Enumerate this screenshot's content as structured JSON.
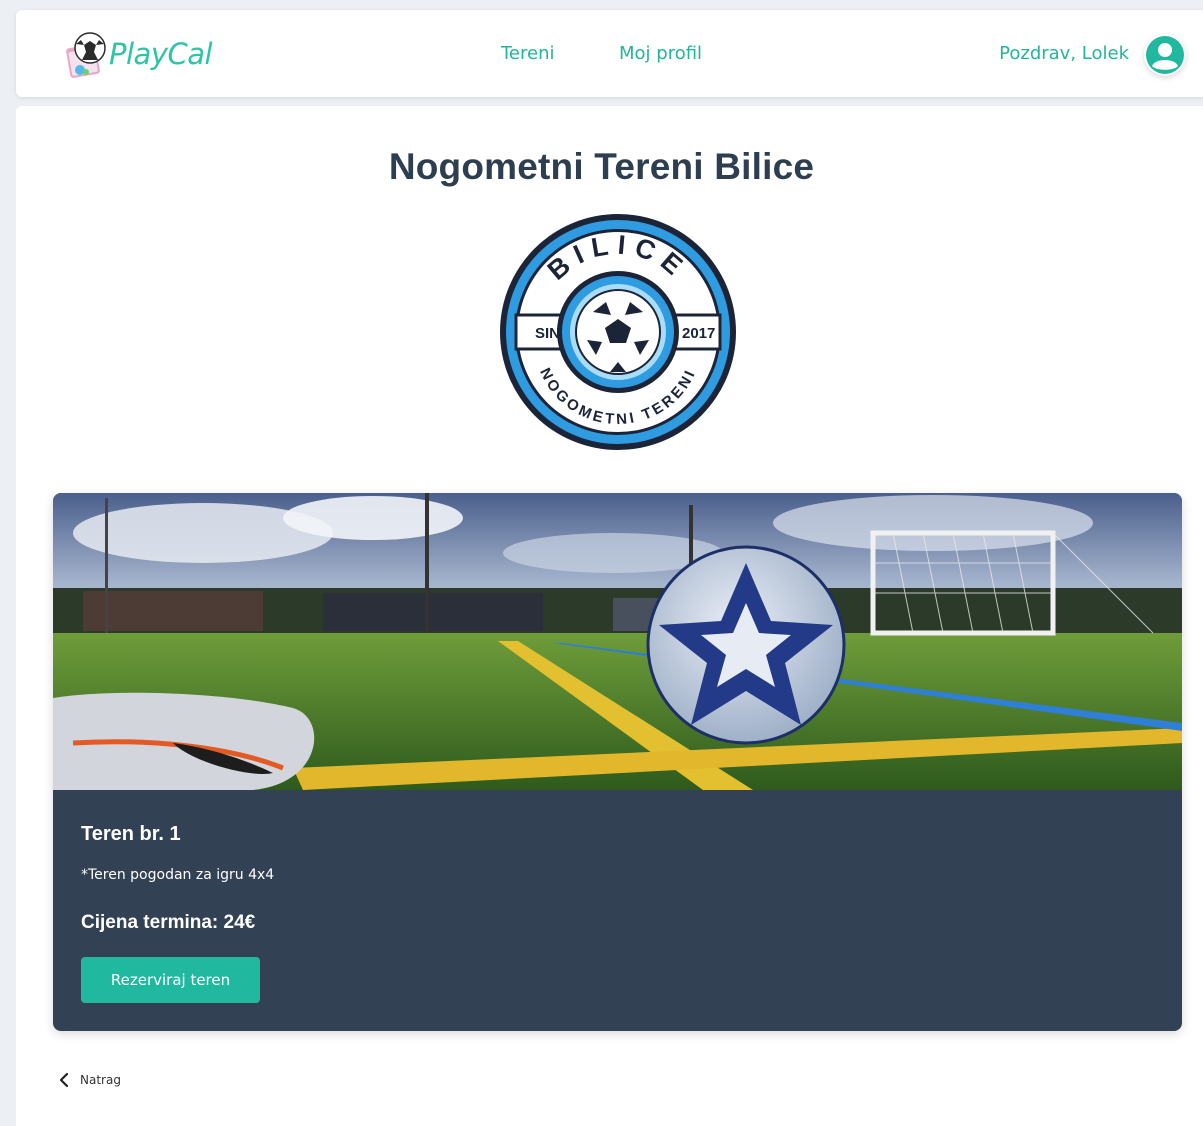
{
  "app": {
    "name": "PlayCal"
  },
  "nav": {
    "links": [
      {
        "label": "Tereni"
      },
      {
        "label": "Moj profil"
      }
    ],
    "greeting": "Pozdrav, Lolek"
  },
  "venue": {
    "title": "Nogometni Tereni Bilice",
    "logo": {
      "top_text": "BILICE",
      "left_text": "SINCE",
      "right_text": "2017",
      "bottom_text": "NOGOMETNI TERENI"
    }
  },
  "court": {
    "name": "Teren br. 1",
    "note": "*Teren pogodan za igru 4x4",
    "price_label": "Cijena termina: 24€",
    "reserve_label": "Rezerviraj teren"
  },
  "back": {
    "label": "Natrag"
  },
  "colors": {
    "accent": "#20b9a0",
    "card_bg": "#334155",
    "title": "#2c3e50",
    "badge_blue": "#2f9be0",
    "badge_navy": "#1c2438"
  },
  "icons": {
    "user": "user-avatar-icon",
    "back": "chevron-left-icon",
    "logo": "soccer-ball-icon"
  }
}
